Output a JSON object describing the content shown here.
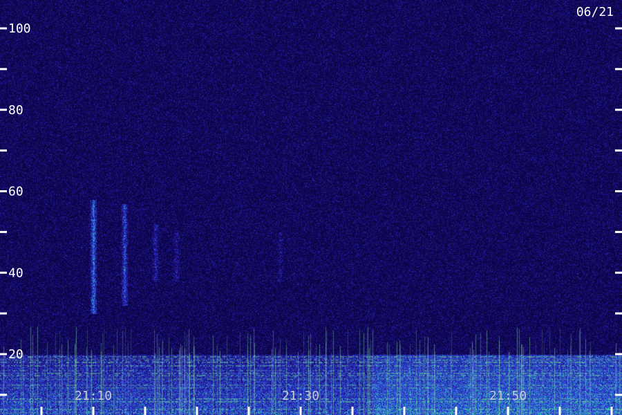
{
  "date_label": "06/21",
  "chart_data": {
    "type": "heatmap",
    "title": "",
    "xlabel": "",
    "ylabel": "",
    "y_axis": {
      "range": [
        0,
        100
      ],
      "major_ticks": [
        20,
        40,
        60,
        80,
        100
      ],
      "major_labels": [
        "20",
        "40",
        "60",
        "80",
        "100"
      ],
      "minor_ticks": [
        10,
        30,
        50,
        70,
        90
      ]
    },
    "x_axis": {
      "range": [
        "21:01",
        "22:01"
      ],
      "tick_labels": [
        {
          "time": "21:10",
          "label": "21:10"
        },
        {
          "time": "21:30",
          "label": "21:30"
        },
        {
          "time": "21:50",
          "label": "21:50"
        }
      ],
      "minor_tick_interval_minutes": 5
    },
    "colors": {
      "background": "#140a52",
      "noise": "#3a24c8",
      "mid": "#2c6cf0",
      "high": "#28e0a0",
      "peak": "#b8ff40",
      "axis": "#ffffff"
    },
    "features": [
      {
        "kind": "low-band",
        "freq_range": [
          0,
          20
        ],
        "time_range": [
          "21:01",
          "22:01"
        ],
        "intensity": 0.9
      },
      {
        "kind": "vertical-streak",
        "time": "21:10",
        "freq_range": [
          30,
          58
        ],
        "intensity": 0.55
      },
      {
        "kind": "vertical-streak",
        "time": "21:13",
        "freq_range": [
          32,
          57
        ],
        "intensity": 0.45
      },
      {
        "kind": "vertical-streak",
        "time": "21:16",
        "freq_range": [
          38,
          52
        ],
        "intensity": 0.25
      },
      {
        "kind": "vertical-streak",
        "time": "21:18",
        "freq_range": [
          38,
          50
        ],
        "intensity": 0.2
      },
      {
        "kind": "vertical-streak",
        "time": "21:28",
        "freq_range": [
          38,
          50
        ],
        "intensity": 0.15
      }
    ]
  }
}
